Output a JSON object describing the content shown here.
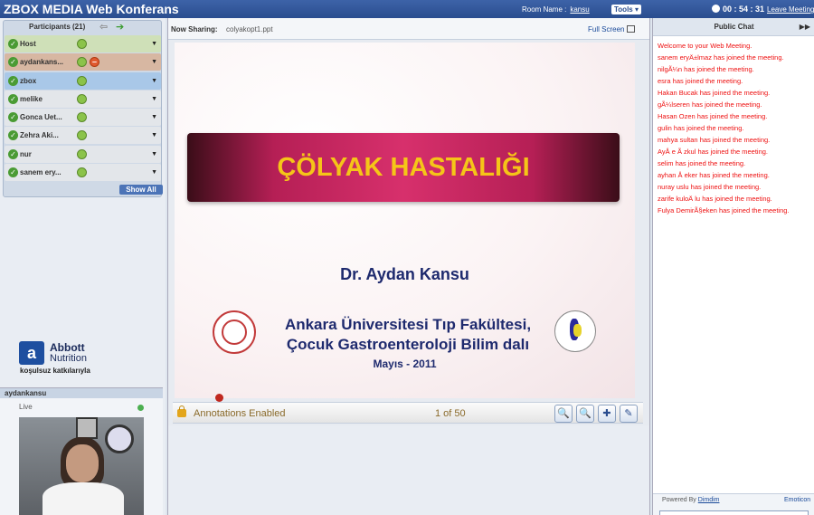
{
  "topbar": {
    "title": "ZBOX MEDIA Web Konferans",
    "room_label": "Room Name :",
    "room_name": "kansu",
    "tools_label": "Tools ▾",
    "timer": "00 : 54 : 31",
    "leave_label": "Leave Meeting"
  },
  "participants": {
    "header": "Participants (21)",
    "show_all": "Show All",
    "items": [
      {
        "name": "Host",
        "color": "#cfe0b8"
      },
      {
        "name": "aydankans...",
        "color": "#d7b7a2"
      },
      {
        "name": "zbox",
        "color": "#a9c8e8"
      },
      {
        "name": "melike",
        "color": "#e3e6ea"
      },
      {
        "name": "Gonca Uet...",
        "color": "#e3e6ea"
      },
      {
        "name": "Zehra Aki...",
        "color": "#e3e6ea"
      },
      {
        "name": "nur",
        "color": "#e3e6ea"
      },
      {
        "name": "sanem ery...",
        "color": "#e3e6ea"
      }
    ]
  },
  "sponsor": {
    "name": "Abbott",
    "sub": "Nutrition",
    "tagline": "koşulsuz katkılarıyla"
  },
  "camera": {
    "user": "aydankansu",
    "status": "Live"
  },
  "sharing": {
    "label": "Now Sharing:",
    "file": "colyakopt1.ppt",
    "fullscreen": "Full Screen"
  },
  "slide": {
    "title": "ÇÖLYAK HASTALIĞI",
    "presenter": "Dr. Aydan Kansu",
    "institution_line1": "Ankara Üniversitesi Tıp Fakültesi,",
    "institution_line2": "Çocuk Gastroenteroloji Bilim dalı",
    "date": "Mayıs - 2011"
  },
  "annotation": {
    "status": "Annotations Enabled",
    "page_count": "1 of 50"
  },
  "chat": {
    "header": "Public Chat",
    "messages": [
      "Welcome to your Web Meeting.",
      "sanem eryÄ±lmaz has joined the meeting.",
      "nilgÃ¼n has joined the meeting.",
      "esra has joined the meeting.",
      "Hakan Bucak has joined the meeting.",
      "gÃ¼lseren has joined the meeting.",
      "Hasan Ozen has joined the meeting.",
      "gulin has joined the meeting.",
      "mahya sultan has joined the meeting.",
      "AyÅ  e Ã   zkul has joined the meeting.",
      "selim has joined the meeting.",
      "ayhan Å   eker has joined the meeting.",
      "nuray uslu has joined the meeting.",
      "zarife kuloÄ   lu has joined the meeting.",
      "Fulya DemirÃ§eken has joined the meeting."
    ],
    "powered_by": "Powered By",
    "powered_link": "Dimdim",
    "emoticon": "Emoticon"
  }
}
